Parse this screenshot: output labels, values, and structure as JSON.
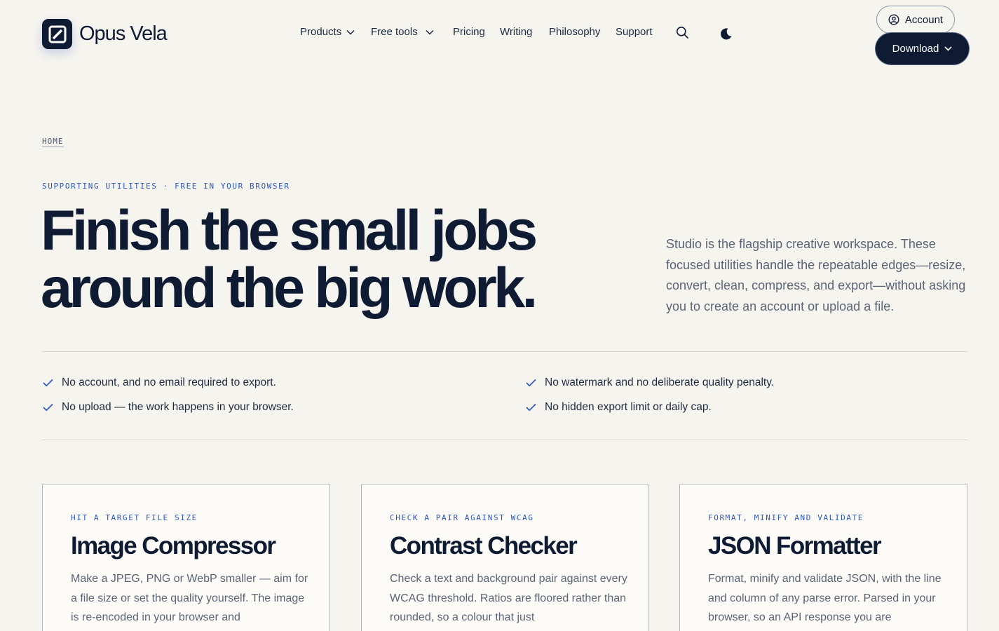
{
  "brand": {
    "name": "Opus Vela"
  },
  "nav": {
    "items": [
      {
        "label": "Products",
        "dropdown": true
      },
      {
        "label": "Free tools",
        "dropdown": true
      },
      {
        "label": "Pricing",
        "dropdown": false
      },
      {
        "label": "Writing",
        "dropdown": false
      },
      {
        "label": "Philosophy",
        "dropdown": false
      },
      {
        "label": "Support",
        "dropdown": false
      }
    ],
    "icons": [
      "search-icon",
      "dark-mode-moon-icon"
    ]
  },
  "header": {
    "account_label": "Account",
    "download_label": "Download"
  },
  "breadcrumb": {
    "home": "HOME"
  },
  "hero": {
    "eyebrow": "SUPPORTING UTILITIES · FREE IN YOUR BROWSER",
    "title": "Finish the small jobs around the big work.",
    "description": "Studio is the flagship creative workspace. These focused utilities handle the repeatable edges—resize, convert, clean, compress, and export—without asking you to create an account or upload a file."
  },
  "checks": [
    "No account, and no email required to export.",
    "No upload — the work happens in your browser.",
    "No watermark and no deliberate quality penalty.",
    "No hidden export limit or daily cap."
  ],
  "cards": [
    {
      "eyebrow": "HIT A TARGET FILE SIZE",
      "title": "Image Compressor",
      "description": "Make a JPEG, PNG or WebP smaller — aim for a file size or set the quality yourself. The image is re-encoded in your browser and"
    },
    {
      "eyebrow": "CHECK A PAIR AGAINST WCAG",
      "title": "Contrast Checker",
      "description": "Check a text and background pair against every WCAG threshold. Ratios are floored rather than rounded, so a colour that just"
    },
    {
      "eyebrow": "FORMAT, MINIFY AND VALIDATE",
      "title": "JSON Formatter",
      "description": "Format, minify and validate JSON, with the line and column of any parse error. Parsed in your browser, so an API response you are"
    }
  ],
  "colors": {
    "background": "#f6f4ef",
    "ink": "#0f1b33",
    "accent": "#2b56c4",
    "muted": "#5b6474"
  }
}
